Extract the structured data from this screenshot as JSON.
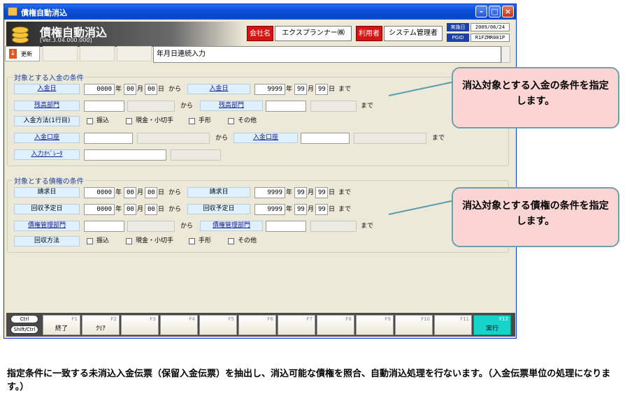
{
  "window": {
    "title": "債権自動消込",
    "app_title": "債権自動消込",
    "version": "[Ver.3.04.000.000]",
    "company_label": "会社名",
    "company_value": "エクスプランナー㈱",
    "user_label": "利用者",
    "user_value": "システム管理者",
    "date_label": "実施日",
    "date_value": "2009/06/24",
    "pgid_label": "PGID",
    "pgid_value": "R1FZMR001P"
  },
  "toolbar": {
    "update_label": "更新",
    "memo_value": "年月日連続入力"
  },
  "payment_section": {
    "title": "対象とする入金の条件",
    "deposit_date_label": "入金日",
    "from_date": {
      "year": "0000",
      "month": "00",
      "day": "00"
    },
    "to_date": {
      "year": "9999",
      "month": "99",
      "day": "99"
    },
    "balance_dept_label": "残高部門",
    "method_label": "入金方法(1行目)",
    "methods": [
      "振込",
      "現金・小切手",
      "手形",
      "その他"
    ],
    "account_label": "入金口座",
    "operator_label": "入力ｵﾍﾟﾚｰﾀ"
  },
  "receivable_section": {
    "title": "対象とする債権の条件",
    "invoice_date_label": "請求日",
    "collection_date_label": "回収予定日",
    "from_date": {
      "year": "0000",
      "month": "00",
      "day": "00"
    },
    "to_date": {
      "year": "9999",
      "month": "99",
      "day": "99"
    },
    "mgmt_dept_label": "債権管理部門",
    "method_label": "回収方法",
    "methods": [
      "振込",
      "現金・小切手",
      "手形",
      "その他"
    ]
  },
  "units": {
    "year": "年",
    "month": "月",
    "day": "日",
    "from": "から",
    "to": "まで"
  },
  "function_keys": {
    "ctrl": "Ctrl",
    "shift_ctrl": "Shift/Ctrl",
    "keys": [
      {
        "key": "F1",
        "label": "終了"
      },
      {
        "key": "F2",
        "label": "ｸﾘｱ"
      },
      {
        "key": "F3",
        "label": ""
      },
      {
        "key": "F4",
        "label": ""
      },
      {
        "key": "F5",
        "label": ""
      },
      {
        "key": "F6",
        "label": ""
      },
      {
        "key": "F7",
        "label": ""
      },
      {
        "key": "F8",
        "label": ""
      },
      {
        "key": "F9",
        "label": ""
      },
      {
        "key": "F10",
        "label": ""
      },
      {
        "key": "F11",
        "label": ""
      },
      {
        "key": "F12",
        "label": "実行"
      }
    ]
  },
  "callouts": {
    "payment": "消込対象とする入金の条件を指定します。",
    "receivable": "消込対象とする債権の条件を指定します。"
  },
  "caption": "指定条件に一致する未消込入金伝票（保留入金伝票）を抽出し、消込可能な債権を照合、自動消込処理を行ないます。（入金伝票単位の処理になります。）"
}
